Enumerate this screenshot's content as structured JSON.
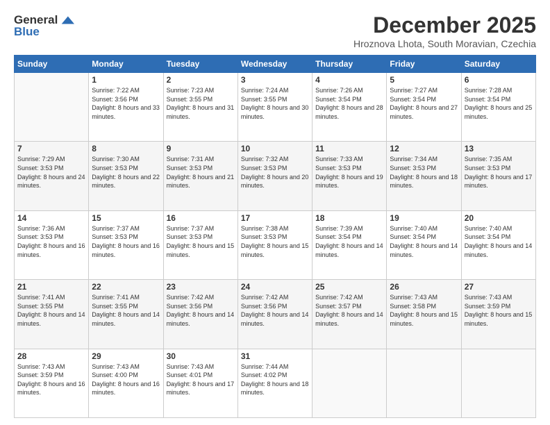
{
  "logo": {
    "general": "General",
    "blue": "Blue"
  },
  "header": {
    "month": "December 2025",
    "location": "Hroznova Lhota, South Moravian, Czechia"
  },
  "weekdays": [
    "Sunday",
    "Monday",
    "Tuesday",
    "Wednesday",
    "Thursday",
    "Friday",
    "Saturday"
  ],
  "weeks": [
    [
      {
        "day": "",
        "sunrise": "",
        "sunset": "",
        "daylight": ""
      },
      {
        "day": "1",
        "sunrise": "7:22 AM",
        "sunset": "3:56 PM",
        "daylight": "8 hours and 33 minutes."
      },
      {
        "day": "2",
        "sunrise": "7:23 AM",
        "sunset": "3:55 PM",
        "daylight": "8 hours and 31 minutes."
      },
      {
        "day": "3",
        "sunrise": "7:24 AM",
        "sunset": "3:55 PM",
        "daylight": "8 hours and 30 minutes."
      },
      {
        "day": "4",
        "sunrise": "7:26 AM",
        "sunset": "3:54 PM",
        "daylight": "8 hours and 28 minutes."
      },
      {
        "day": "5",
        "sunrise": "7:27 AM",
        "sunset": "3:54 PM",
        "daylight": "8 hours and 27 minutes."
      },
      {
        "day": "6",
        "sunrise": "7:28 AM",
        "sunset": "3:54 PM",
        "daylight": "8 hours and 25 minutes."
      }
    ],
    [
      {
        "day": "7",
        "sunrise": "7:29 AM",
        "sunset": "3:53 PM",
        "daylight": "8 hours and 24 minutes."
      },
      {
        "day": "8",
        "sunrise": "7:30 AM",
        "sunset": "3:53 PM",
        "daylight": "8 hours and 22 minutes."
      },
      {
        "day": "9",
        "sunrise": "7:31 AM",
        "sunset": "3:53 PM",
        "daylight": "8 hours and 21 minutes."
      },
      {
        "day": "10",
        "sunrise": "7:32 AM",
        "sunset": "3:53 PM",
        "daylight": "8 hours and 20 minutes."
      },
      {
        "day": "11",
        "sunrise": "7:33 AM",
        "sunset": "3:53 PM",
        "daylight": "8 hours and 19 minutes."
      },
      {
        "day": "12",
        "sunrise": "7:34 AM",
        "sunset": "3:53 PM",
        "daylight": "8 hours and 18 minutes."
      },
      {
        "day": "13",
        "sunrise": "7:35 AM",
        "sunset": "3:53 PM",
        "daylight": "8 hours and 17 minutes."
      }
    ],
    [
      {
        "day": "14",
        "sunrise": "7:36 AM",
        "sunset": "3:53 PM",
        "daylight": "8 hours and 16 minutes."
      },
      {
        "day": "15",
        "sunrise": "7:37 AM",
        "sunset": "3:53 PM",
        "daylight": "8 hours and 16 minutes."
      },
      {
        "day": "16",
        "sunrise": "7:37 AM",
        "sunset": "3:53 PM",
        "daylight": "8 hours and 15 minutes."
      },
      {
        "day": "17",
        "sunrise": "7:38 AM",
        "sunset": "3:53 PM",
        "daylight": "8 hours and 15 minutes."
      },
      {
        "day": "18",
        "sunrise": "7:39 AM",
        "sunset": "3:54 PM",
        "daylight": "8 hours and 14 minutes."
      },
      {
        "day": "19",
        "sunrise": "7:40 AM",
        "sunset": "3:54 PM",
        "daylight": "8 hours and 14 minutes."
      },
      {
        "day": "20",
        "sunrise": "7:40 AM",
        "sunset": "3:54 PM",
        "daylight": "8 hours and 14 minutes."
      }
    ],
    [
      {
        "day": "21",
        "sunrise": "7:41 AM",
        "sunset": "3:55 PM",
        "daylight": "8 hours and 14 minutes."
      },
      {
        "day": "22",
        "sunrise": "7:41 AM",
        "sunset": "3:55 PM",
        "daylight": "8 hours and 14 minutes."
      },
      {
        "day": "23",
        "sunrise": "7:42 AM",
        "sunset": "3:56 PM",
        "daylight": "8 hours and 14 minutes."
      },
      {
        "day": "24",
        "sunrise": "7:42 AM",
        "sunset": "3:56 PM",
        "daylight": "8 hours and 14 minutes."
      },
      {
        "day": "25",
        "sunrise": "7:42 AM",
        "sunset": "3:57 PM",
        "daylight": "8 hours and 14 minutes."
      },
      {
        "day": "26",
        "sunrise": "7:43 AM",
        "sunset": "3:58 PM",
        "daylight": "8 hours and 15 minutes."
      },
      {
        "day": "27",
        "sunrise": "7:43 AM",
        "sunset": "3:59 PM",
        "daylight": "8 hours and 15 minutes."
      }
    ],
    [
      {
        "day": "28",
        "sunrise": "7:43 AM",
        "sunset": "3:59 PM",
        "daylight": "8 hours and 16 minutes."
      },
      {
        "day": "29",
        "sunrise": "7:43 AM",
        "sunset": "4:00 PM",
        "daylight": "8 hours and 16 minutes."
      },
      {
        "day": "30",
        "sunrise": "7:43 AM",
        "sunset": "4:01 PM",
        "daylight": "8 hours and 17 minutes."
      },
      {
        "day": "31",
        "sunrise": "7:44 AM",
        "sunset": "4:02 PM",
        "daylight": "8 hours and 18 minutes."
      },
      {
        "day": "",
        "sunrise": "",
        "sunset": "",
        "daylight": ""
      },
      {
        "day": "",
        "sunrise": "",
        "sunset": "",
        "daylight": ""
      },
      {
        "day": "",
        "sunrise": "",
        "sunset": "",
        "daylight": ""
      }
    ]
  ]
}
